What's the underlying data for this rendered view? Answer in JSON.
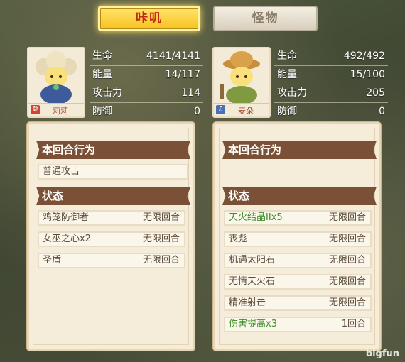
{
  "tabs": {
    "active": "咔叽",
    "inactive": "怪物"
  },
  "left": {
    "name": "莉莉",
    "stats": [
      {
        "label": "生命",
        "value": "4141/4141"
      },
      {
        "label": "能量",
        "value": "14/117"
      },
      {
        "label": "攻击力",
        "value": "114"
      },
      {
        "label": "防御",
        "value": "0"
      }
    ],
    "action_title": "本回合行为",
    "action": "普通攻击",
    "status_title": "状态",
    "statuses": [
      {
        "name": "鸡笼防御者",
        "duration": "无限回合",
        "green": false
      },
      {
        "name": "女巫之心x2",
        "duration": "无限回合",
        "green": false
      },
      {
        "name": "圣盾",
        "duration": "无限回合",
        "green": false
      }
    ]
  },
  "right": {
    "name": "麦朵",
    "stats": [
      {
        "label": "生命",
        "value": "492/492"
      },
      {
        "label": "能量",
        "value": "15/100"
      },
      {
        "label": "攻击力",
        "value": "205"
      },
      {
        "label": "防御",
        "value": "0"
      }
    ],
    "action_title": "本回合行为",
    "status_title": "状态",
    "statuses": [
      {
        "name": "天火结晶IIx5",
        "duration": "无限回合",
        "green": true
      },
      {
        "name": "丧彪",
        "duration": "无限回合",
        "green": false
      },
      {
        "name": "机遇太阳石",
        "duration": "无限回合",
        "green": false
      },
      {
        "name": "无情天火石",
        "duration": "无限回合",
        "green": false
      },
      {
        "name": "精准射击",
        "duration": "无限回合",
        "green": false
      },
      {
        "name": "伤害提高x3",
        "duration": "1回合",
        "green": true
      }
    ]
  },
  "watermark": "bigfun",
  "colors": {
    "accent": "#f7c21f",
    "header": "#7a5036",
    "buff_green": "#3e8f2c",
    "panel": "#f5ecd9"
  }
}
